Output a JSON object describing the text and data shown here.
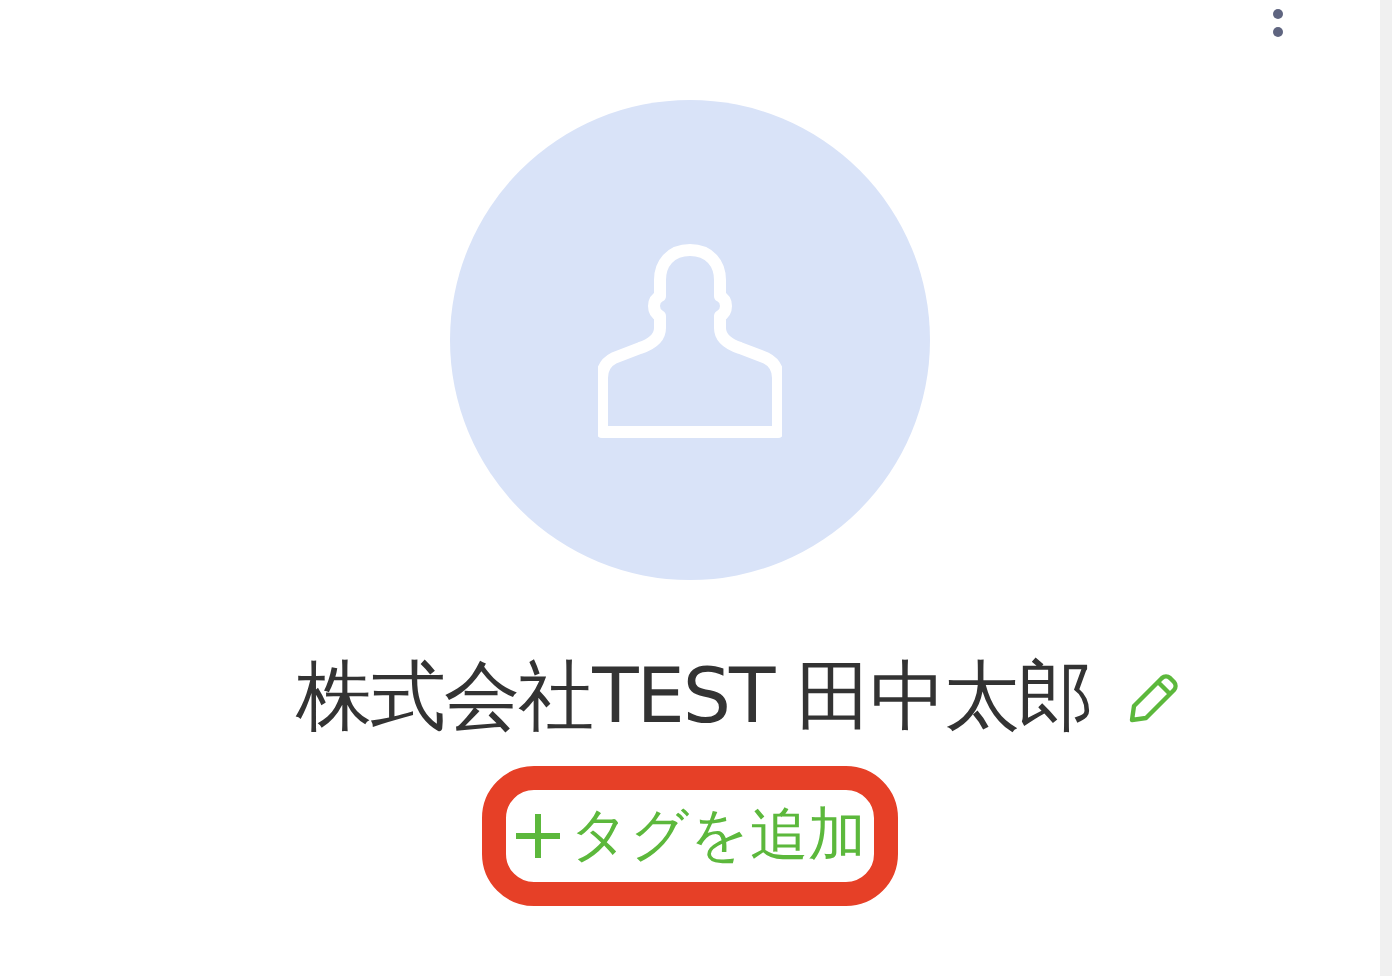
{
  "contact": {
    "name": "株式会社TEST 田中太郎"
  },
  "tag_button": {
    "label": "タグを追加",
    "highlighted": true
  }
}
